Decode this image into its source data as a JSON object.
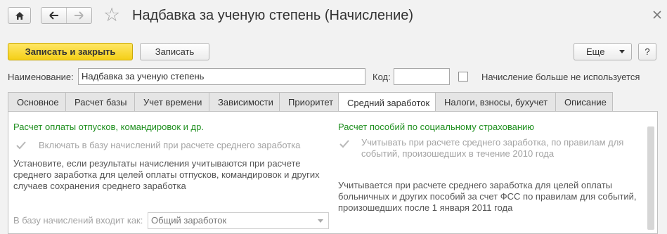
{
  "window": {
    "title": "Надбавка за ученую степень (Начисление)"
  },
  "toolbar": {
    "save_close_label": "Записать и закрыть",
    "save_label": "Записать",
    "more_label": "Еще",
    "help_label": "?"
  },
  "form": {
    "name_label": "Наименование:",
    "name_value": "Надбавка за ученую степень",
    "code_label": "Код:",
    "code_value": "",
    "not_used_label": "Начисление больше не используется"
  },
  "tabs": [
    {
      "label": "Основное"
    },
    {
      "label": "Расчет базы"
    },
    {
      "label": "Учет времени"
    },
    {
      "label": "Зависимости"
    },
    {
      "label": "Приоритет"
    },
    {
      "label": "Средний заработок"
    },
    {
      "label": "Налоги, взносы, бухучет"
    },
    {
      "label": "Описание"
    }
  ],
  "active_tab": "Средний заработок",
  "left": {
    "section_title": "Расчет оплаты отпусков, командировок и др.",
    "include_checkbox_label": "Включать в базу начислений при расчете среднего заработка",
    "hint_lines": [
      "Установите, если результаты начисления учитываются при расчете",
      "среднего заработка для целей оплаты отпусков, командировок и других",
      "случаев сохранения среднего заработка"
    ],
    "base_label": "В базу начислений входит как:",
    "base_value": "Общий заработок"
  },
  "right": {
    "section_title": "Расчет пособий по социальному страхованию",
    "check_label_lines": [
      "Учитывать при расчете среднего заработка, по правилам для",
      "событий, произошедших в течение 2010 года"
    ],
    "info_lines": [
      "Учитывается при расчете среднего заработка для целей оплаты",
      "больничных и других пособий за счет ФСС по правилам для событий,",
      "произошедших после 1 января 2011 года"
    ]
  },
  "colors": {
    "accent_button": "#f4cf17",
    "section_title": "#1f8f1f"
  }
}
